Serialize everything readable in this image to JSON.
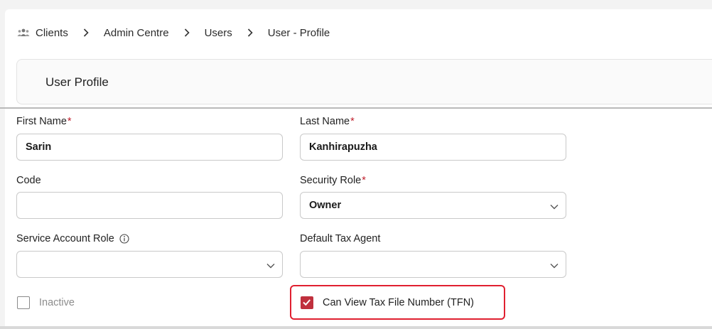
{
  "breadcrumb": {
    "items": [
      "Clients",
      "Admin Centre",
      "Users",
      "User - Profile"
    ],
    "icon": "clients-group-icon"
  },
  "header": {
    "title": "User Profile"
  },
  "form": {
    "first_name": {
      "label": "First Name",
      "required": "*",
      "value": "Sarin"
    },
    "last_name": {
      "label": "Last Name",
      "required": "*",
      "value": "Kanhirapuzha"
    },
    "code": {
      "label": "Code",
      "value": ""
    },
    "security_role": {
      "label": "Security Role",
      "required": "*",
      "value": "Owner"
    },
    "service_account_role": {
      "label": "Service Account Role",
      "value": ""
    },
    "default_tax_agent": {
      "label": "Default Tax Agent",
      "value": ""
    },
    "inactive": {
      "label": "Inactive",
      "checked": false
    },
    "can_view_tfn": {
      "label": "Can View Tax File Number (TFN)",
      "checked": true
    }
  },
  "colors": {
    "accent": "#c0303d",
    "highlight_border": "#e02030",
    "required": "#c0202d"
  }
}
